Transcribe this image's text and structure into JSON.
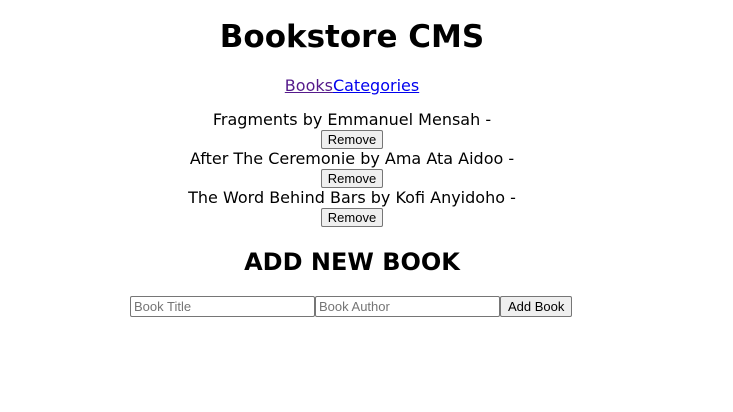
{
  "header": {
    "title": "Bookstore CMS"
  },
  "nav": {
    "books_label": "Books",
    "categories_label": "Categories"
  },
  "books": [
    {
      "text": "Fragments by Emmanuel Mensah -",
      "remove_label": "Remove"
    },
    {
      "text": "After The Ceremonie by Ama Ata Aidoo -",
      "remove_label": "Remove"
    },
    {
      "text": "The Word Behind Bars by Kofi Anyidoho -",
      "remove_label": "Remove"
    }
  ],
  "add_form": {
    "heading": "ADD NEW BOOK",
    "title_placeholder": "Book Title",
    "title_value": "",
    "author_placeholder": "Book Author",
    "author_value": "",
    "submit_label": "Add Book"
  },
  "colors": {
    "link_visited": "#551a8b",
    "link_unvisited": "#0000ee",
    "button_bg": "#efefef",
    "button_border": "#767676"
  }
}
